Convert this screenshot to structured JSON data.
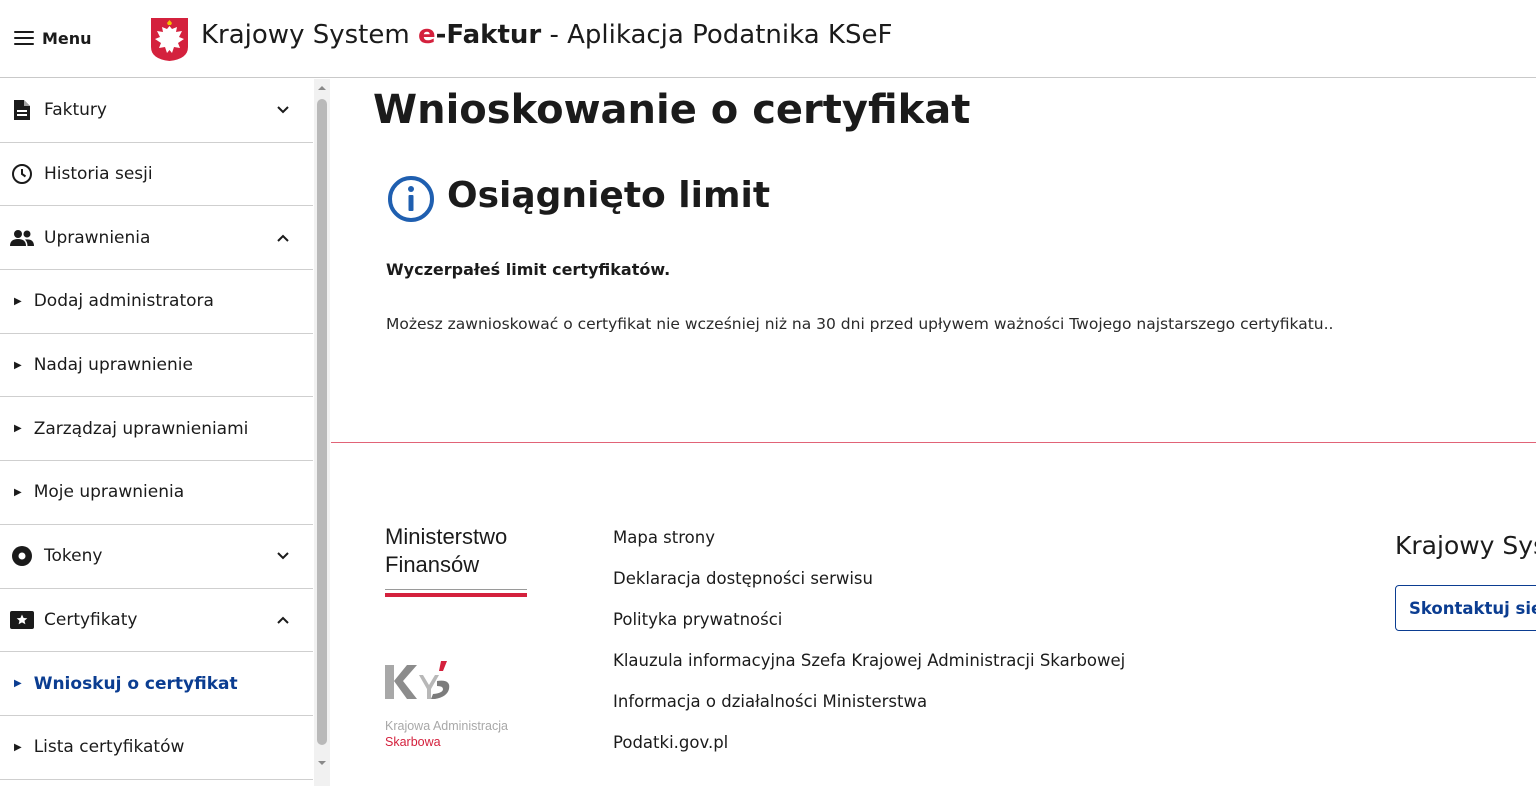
{
  "header": {
    "menu_label": "Menu",
    "title_prefix": "Krajowy System ",
    "title_e": "e",
    "title_brand": "-Faktur",
    "title_suffix": " - Aplikacja Podatnika KSeF"
  },
  "sidebar": {
    "items": [
      {
        "label": "Faktury",
        "icon": "document-icon",
        "expanded": false
      },
      {
        "label": "Historia sesji",
        "icon": "clock-icon"
      },
      {
        "label": "Uprawnienia",
        "icon": "people-icon",
        "expanded": true
      },
      {
        "label": "Dodaj administratora"
      },
      {
        "label": "Nadaj uprawnienie"
      },
      {
        "label": "Zarządzaj uprawnieniami"
      },
      {
        "label": "Moje uprawnienia"
      },
      {
        "label": "Tokeny",
        "icon": "token-icon",
        "expanded": false
      },
      {
        "label": "Certyfikaty",
        "icon": "certificate-icon",
        "expanded": true
      },
      {
        "label": "Wnioskuj o certyfikat",
        "active": true
      },
      {
        "label": "Lista certyfikatów"
      }
    ]
  },
  "main": {
    "page_title": "Wnioskowanie o certyfikat",
    "section_title": "Osiągnięto limit",
    "message_bold": "Wyczerpałeś limit certyfikatów.",
    "message_text": "Możesz zawnioskować o certyfikat nie wcześniej niż na 30 dni przed upływem ważności Twojego najstarszego certyfikatu.."
  },
  "footer": {
    "mf_line1": "Ministerstwo",
    "mf_line2": "Finansów",
    "kas_line1": "Krajowa Administracja",
    "kas_line2": "Skarbowa",
    "links": [
      "Mapa strony",
      "Deklaracja dostępności serwisu",
      "Polityka prywatności",
      "Klauzula informacyjna Szefa Krajowej Administracji Skarbowej",
      "Informacja o działalności Ministerstwa",
      "Podatki.gov.pl"
    ],
    "right_title": "Krajowy Sys",
    "contact_label": "Skontaktuj się"
  },
  "colors": {
    "accent_red": "#d4213d",
    "link_blue": "#0b3d91",
    "info_blue": "#1f5fb0"
  }
}
